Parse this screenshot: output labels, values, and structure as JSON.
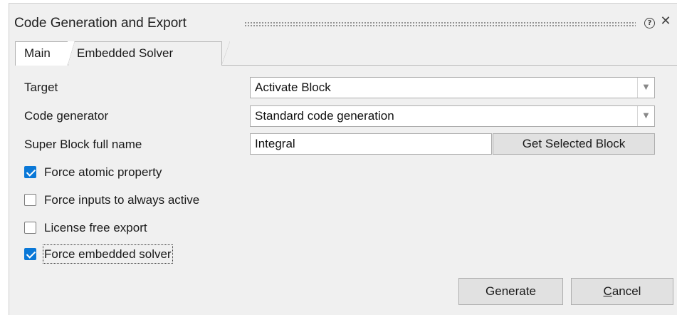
{
  "dialog": {
    "title": "Code Generation and Export",
    "help_icon": "help-icon",
    "close_icon": "close-icon",
    "help_glyph": "?",
    "close_glyph": "✕"
  },
  "tabs": [
    {
      "label": "Main",
      "active": true
    },
    {
      "label": "Embedded Solver",
      "active": false
    }
  ],
  "form": {
    "target": {
      "label": "Target",
      "value": "Activate Block"
    },
    "code_generator": {
      "label": "Code generator",
      "value": "Standard code generation"
    },
    "super_block": {
      "label": "Super Block full name",
      "value": "Integral",
      "button_label": "Get Selected Block"
    },
    "dropdown_glyph": "▼"
  },
  "checkboxes": [
    {
      "label": "Force atomic property",
      "checked": true
    },
    {
      "label": "Force inputs to always active",
      "checked": false
    },
    {
      "label": "License free export",
      "checked": false
    },
    {
      "label": "Force embedded solver",
      "checked": true
    }
  ],
  "buttons": {
    "generate": "Generate",
    "cancel_first": "C",
    "cancel_rest": "ancel"
  },
  "colors": {
    "accent": "#0a78d7",
    "panel_bg": "#f0f0f0"
  }
}
